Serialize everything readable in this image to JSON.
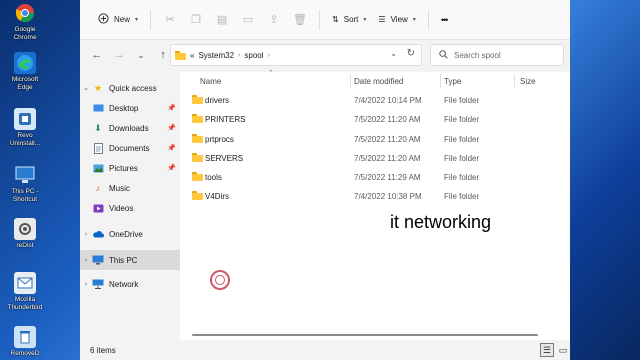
{
  "desktop": {
    "icons": [
      {
        "label": "Google Chrome",
        "icon": "chrome-icon"
      },
      {
        "label": "Microsoft Edge",
        "icon": "edge-icon"
      },
      {
        "label": "Revo Uninstall...",
        "icon": "revo-uninstaller-icon"
      },
      {
        "label": "This PC - Shortcut",
        "icon": "this-pc-icon"
      },
      {
        "label": "reDist",
        "icon": "redist-icon"
      },
      {
        "label": "Mozilla Thunderbird",
        "icon": "thunderbird-icon"
      },
      {
        "label": "RemoveD",
        "icon": "recycle-icon"
      }
    ]
  },
  "commandbar": {
    "new_label": "New",
    "sort_label": "Sort",
    "view_label": "View",
    "more_glyph": "•••"
  },
  "address": {
    "overflow": "«",
    "crumbs": [
      "System32",
      "spool"
    ]
  },
  "search": {
    "placeholder": "Search spool"
  },
  "sidebar": {
    "quick_access": "Quick access",
    "items": [
      {
        "label": "Desktop",
        "icon": "desktop-icon",
        "pinned": true
      },
      {
        "label": "Downloads",
        "icon": "downloads-icon",
        "pinned": true
      },
      {
        "label": "Documents",
        "icon": "documents-icon",
        "pinned": true
      },
      {
        "label": "Pictures",
        "icon": "pictures-icon",
        "pinned": true
      },
      {
        "label": "Music",
        "icon": "music-icon",
        "pinned": false
      },
      {
        "label": "Videos",
        "icon": "videos-icon",
        "pinned": false
      }
    ],
    "onedrive": "OneDrive",
    "this_pc": "This PC",
    "network": "Network"
  },
  "columns": {
    "name": "Name",
    "date_modified": "Date modified",
    "type": "Type",
    "size": "Size"
  },
  "files": [
    {
      "name": "drivers",
      "date": "7/4/2022 10:14 PM",
      "type": "File folder"
    },
    {
      "name": "PRINTERS",
      "date": "7/5/2022 11:20 AM",
      "type": "File folder"
    },
    {
      "name": "prtprocs",
      "date": "7/5/2022 11:20 AM",
      "type": "File folder"
    },
    {
      "name": "SERVERS",
      "date": "7/5/2022 11:20 AM",
      "type": "File folder"
    },
    {
      "name": "tools",
      "date": "7/5/2022 11:29 AM",
      "type": "File folder"
    },
    {
      "name": "V4Dirs",
      "date": "7/4/2022 10:38 PM",
      "type": "File folder"
    }
  ],
  "caption": "it networking",
  "status": {
    "item_count": "6 items"
  },
  "colors": {
    "folder": "#ffc83d",
    "selected": "#dadada",
    "accent": "#0067c0"
  }
}
